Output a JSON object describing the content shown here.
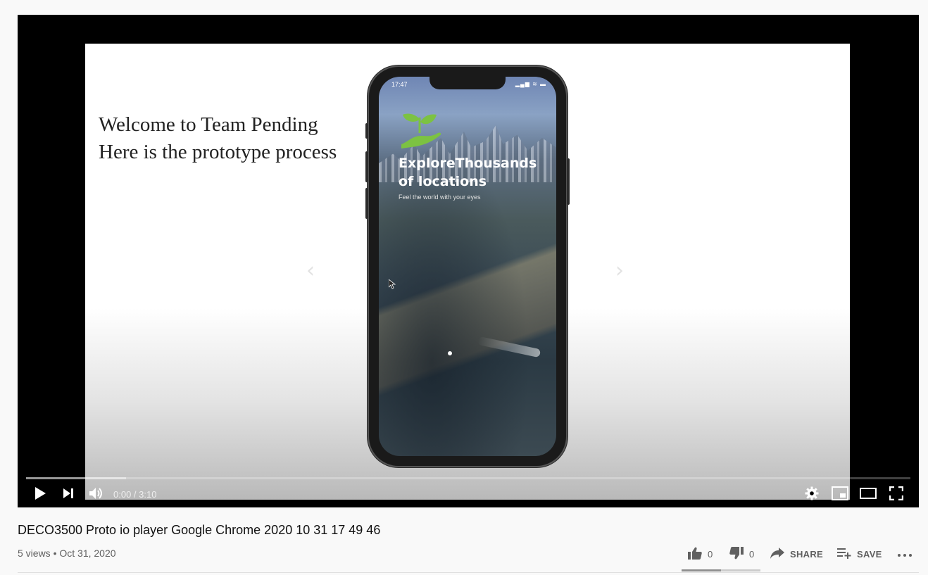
{
  "player": {
    "slide": {
      "line1": "Welcome to Team Pending",
      "line2": "Here is the prototype process"
    },
    "phone_screen": {
      "time": "17:47",
      "status_icons": "▂▄▆ ≋ ▬",
      "app_title_line1": "ExploreThousands",
      "app_title_line2": "of locations",
      "app_subtitle": "Feel the world with your eyes"
    },
    "progress_buffered_fraction": 0.113,
    "time_display": "0:00 / 3:10",
    "controls": {
      "play_icon": "play-icon",
      "next_icon": "next-icon",
      "volume_icon": "volume-icon",
      "settings_icon": "gear-icon",
      "miniplayer_icon": "miniplayer-icon",
      "theater_icon": "theater-mode-icon",
      "fullscreen_icon": "fullscreen-icon"
    }
  },
  "video": {
    "title": "DECO3500 Proto io player Google Chrome 2020 10 31 17 49 46",
    "meta": "5 views • Oct 31, 2020"
  },
  "actions": {
    "like_count": "0",
    "dislike_count": "0",
    "share_label": "SHARE",
    "save_label": "SAVE"
  },
  "colors": {
    "page_bg": "#f9f9f9",
    "player_bg": "#000000",
    "accent_green": "#7cc242",
    "text_secondary": "#606060"
  }
}
